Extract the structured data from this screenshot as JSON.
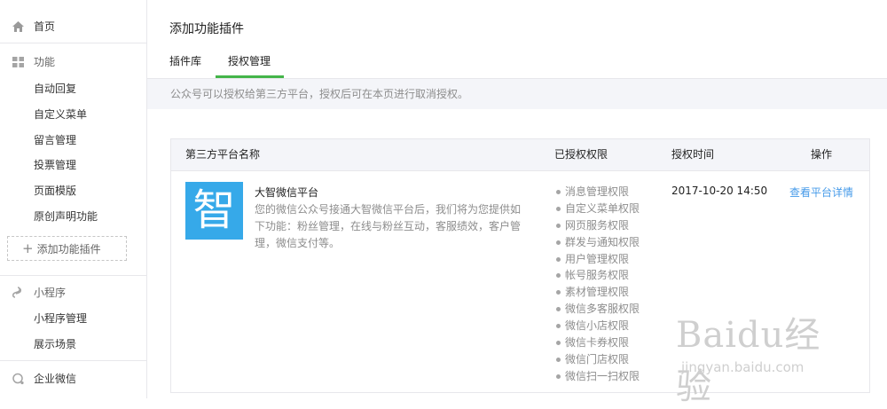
{
  "sidebar": {
    "home": "首页",
    "features": {
      "label": "功能",
      "items": [
        "自动回复",
        "自定义菜单",
        "留言管理",
        "投票管理",
        "页面模版",
        "原创声明功能"
      ],
      "add_plugin": "添加功能插件"
    },
    "miniprogram": {
      "label": "小程序",
      "items": [
        "小程序管理",
        "展示场景"
      ]
    },
    "enterprise": "企业微信"
  },
  "main": {
    "title": "添加功能插件",
    "tabs": [
      {
        "label": "插件库",
        "active": false
      },
      {
        "label": "授权管理",
        "active": true
      }
    ],
    "notice": "公众号可以授权给第三方平台，授权后可在本页进行取消授权。",
    "table": {
      "headers": [
        "第三方平台名称",
        "已授权权限",
        "授权时间",
        "操作"
      ],
      "rows": [
        {
          "logo_char": "智",
          "name": "大智微信平台",
          "description": "您的微信公众号接通大智微信平台后，我们将为您提供如下功能：粉丝管理，在线与粉丝互动，客服绩效，客户管理，微信支付等。",
          "permissions": [
            "消息管理权限",
            "自定义菜单权限",
            "网页服务权限",
            "群发与通知权限",
            "用户管理权限",
            "帐号服务权限",
            "素材管理权限",
            "微信多客服权限",
            "微信小店权限",
            "微信卡券权限",
            "微信门店权限",
            "微信扫一扫权限"
          ],
          "auth_time": "2017-10-20 14:50",
          "action": "查看平台详情"
        }
      ]
    }
  },
  "watermark": {
    "text": "Baidu经验",
    "url": "jingyan.baidu.com"
  },
  "colors": {
    "accent": "#44b549",
    "link": "#459ae9",
    "logo_bg": "#36a9e9"
  }
}
